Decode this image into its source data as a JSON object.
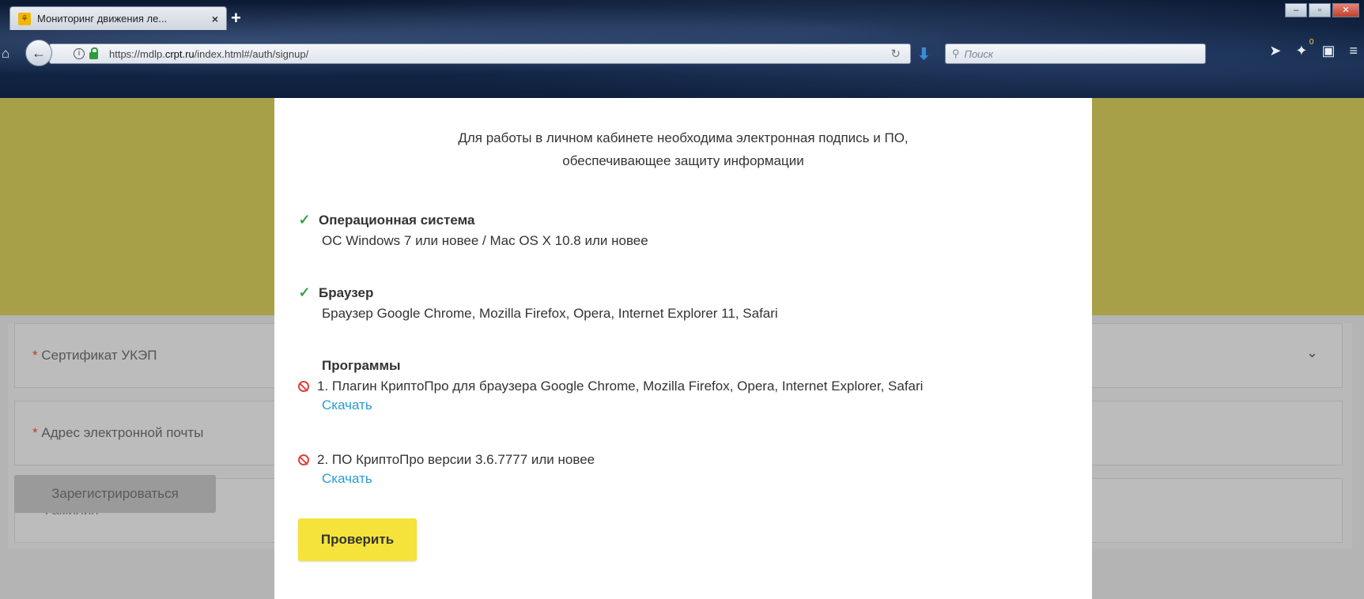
{
  "browser": {
    "tab_title": "Мониторинг движения ле...",
    "tab_close": "×",
    "new_tab": "+",
    "url_prefix": "https://mdlp.",
    "url_domain": "crpt.ru",
    "url_suffix": "/index.html#/auth/signup/",
    "search_placeholder": "Поиск",
    "notification_count": "0"
  },
  "form": {
    "fields": [
      {
        "required_mark": "*",
        "label": "Сертификат УКЭП"
      },
      {
        "required_mark": "*",
        "label": "Адрес электронной почты"
      },
      {
        "required_mark": "*",
        "label": "Фамилия"
      }
    ],
    "register_button": "Зарегистрироваться"
  },
  "modal": {
    "intro_line1": "Для работы в личном кабинете необходима электронная подпись и ПО,",
    "intro_line2": "обеспечивающее защиту информации",
    "os": {
      "title": "Операционная система",
      "description": "ОС Windows 7 или новее / Mac OS X 10.8 или новее",
      "status": "ok"
    },
    "browser": {
      "title": "Браузер",
      "description": "Браузер Google Chrome, Mozilla Firefox, Opera, Internet Explorer 11, Safari",
      "status": "ok"
    },
    "programs": {
      "title": "Программы",
      "items": [
        {
          "text": "1. Плагин КриптоПро для браузера Google Chrome, Mozilla Firefox, Opera, Internet Explorer, Safari",
          "link": "Скачать",
          "status": "missing"
        },
        {
          "text": "2. ПО КриптоПро версии 3.6.7777 или новее",
          "link": "Скачать",
          "status": "missing"
        }
      ]
    },
    "check_button": "Проверить"
  },
  "colors": {
    "banner": "#a8a048",
    "check_button": "#f5e23a",
    "ok_icon": "#3aa14a",
    "missing_icon": "#e0423a",
    "link": "#2a9bd6"
  }
}
